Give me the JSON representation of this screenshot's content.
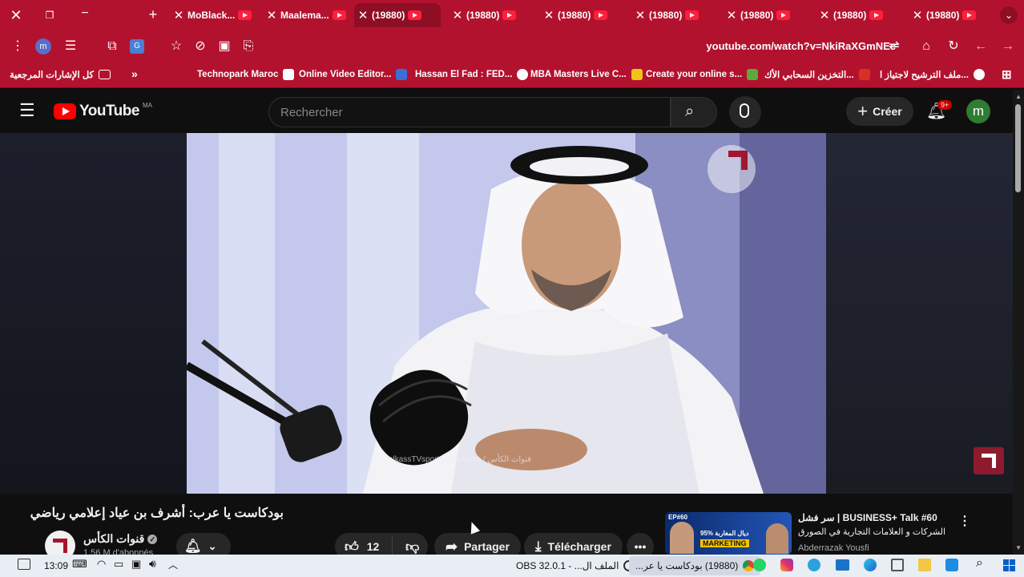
{
  "tabs": [
    {
      "title": "MoBlack..."
    },
    {
      "title": "Maalema..."
    },
    {
      "title": "(19880)"
    },
    {
      "title": "(19880)"
    },
    {
      "title": "(19880)"
    },
    {
      "title": "(19880)"
    },
    {
      "title": "(19880)"
    },
    {
      "title": "(19880)"
    },
    {
      "title": "(19880)"
    }
  ],
  "toolbar": {
    "url": "youtube.com/watch?v=NkiRaXGmNEc",
    "profile_letter": "m"
  },
  "bookmarks": {
    "folder": "كل الإشارات المرجعية",
    "items": [
      {
        "label": "Technopark Maroc"
      },
      {
        "label": "Online Video Editor..."
      },
      {
        "label": "Hassan El Fad : FED..."
      },
      {
        "label": "MBA Masters Live C..."
      },
      {
        "label": "Create your online s..."
      },
      {
        "label": "التخزين السحابي الأك..."
      },
      {
        "label": "ملف الترشيح لاجتياز ا..."
      }
    ]
  },
  "youtube": {
    "logo_text": "YouTube",
    "region": "MA",
    "search_placeholder": "Rechercher",
    "create_label": "Créer",
    "notif_count": "9+",
    "avatar_letter": "m"
  },
  "video": {
    "title": "بودكاست يا عرب: أشرف بن عياد إعلامي رياضي",
    "watermark": "alkassTVsports / @alkass / قنوات الكأس"
  },
  "channel": {
    "name": "قنوات الكأس",
    "subscribers": "1,56 M d'abonnés"
  },
  "actions": {
    "likes": "12",
    "share": "Partager",
    "download": "Télécharger"
  },
  "suggestion": {
    "title_line1": "سر فشل | BUSINESS+ Talk #60",
    "title_line2": "الشركات و العلامات التجارية في الصورق",
    "channel": "Abderrazak Yousfi",
    "thumb_badge": "EP#60",
    "thumb_text1": "95% ديال المغاربة",
    "thumb_text2": "MARKETING"
  },
  "taskbar": {
    "time": "13:09",
    "task1": "الملف ال... - OBS 32.0.1",
    "task2": "(19880) بودكاست يا عر..."
  }
}
